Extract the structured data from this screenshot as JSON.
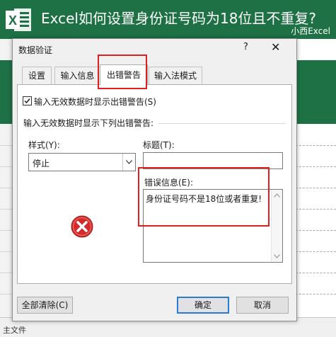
{
  "banner": {
    "title": "Excel如何设置身份证号码为18位且不重复?",
    "brand": "小西Excel",
    "logo_icon": "excel-logo-icon",
    "logo_letter": "X"
  },
  "dialog": {
    "title": "数据验证",
    "help_glyph": "?",
    "close_glyph": "✕",
    "tabs": [
      {
        "label": "设置",
        "active": false
      },
      {
        "label": "输入信息",
        "active": false
      },
      {
        "label": "出错警告",
        "active": true
      },
      {
        "label": "输入法模式",
        "active": false
      }
    ],
    "show_alert_checkbox": {
      "label": "输入无效数据时显示出错警告(S)",
      "checked": true
    },
    "group_label": "输入无效数据时显示下列出错警告:",
    "style": {
      "label": "样式(Y):",
      "value": "停止"
    },
    "title_field": {
      "label": "标题(T):",
      "value": ""
    },
    "error_message": {
      "label": "错误信息(E):",
      "value": "身份证号码不是18位或者重复!"
    },
    "stop_icon": "error-stop-icon",
    "buttons": {
      "clear_all": "全部清除(C)",
      "ok": "确定",
      "cancel": "取消"
    }
  },
  "sheet": {
    "bottom_label": "主文件"
  },
  "colors": {
    "excel_green": "#1e7145",
    "highlight_red": "#e02020",
    "stop_red": "#d42a2a",
    "default_button_border": "#2b79d8"
  }
}
